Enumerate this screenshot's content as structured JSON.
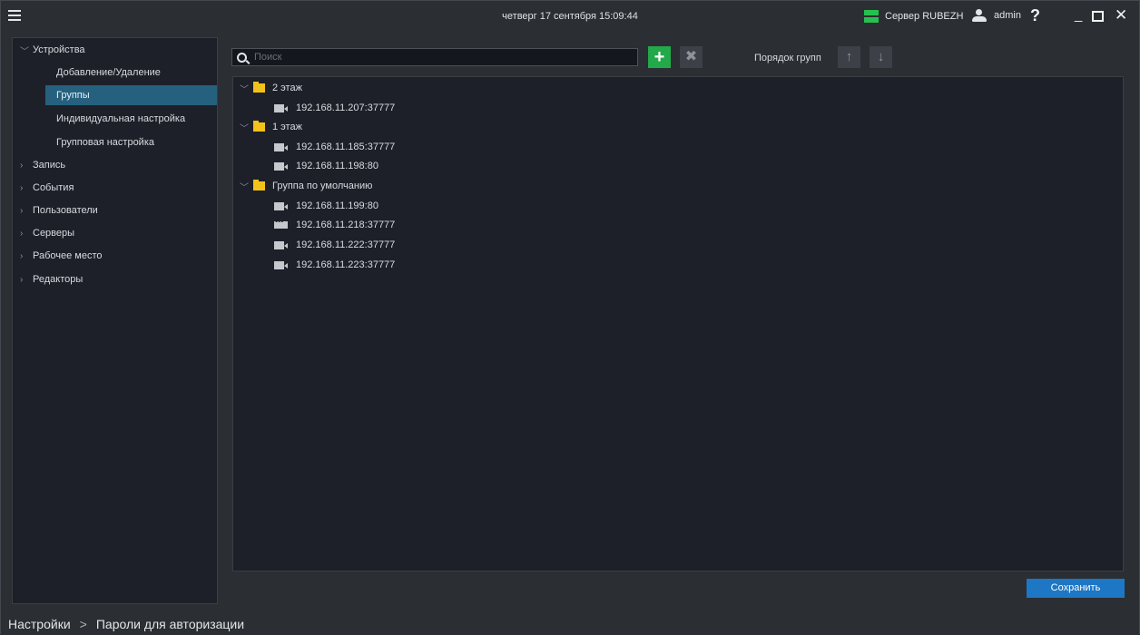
{
  "titlebar": {
    "datetime": "четверг 17 сентября 15:09:44",
    "server_label": "Сервер RUBEZH",
    "user_label": "admin",
    "help_label": "?",
    "minimize_label": "_",
    "close_label": "✕"
  },
  "sidebar": {
    "root": "Устройства",
    "children": [
      "Добавление/Удаление",
      "Группы",
      "Индивидуальная настройка",
      "Групповая настройка"
    ],
    "selected": "Группы",
    "sections": [
      "Запись",
      "События",
      "Пользователи",
      "Серверы",
      "Рабочее место",
      "Редакторы"
    ]
  },
  "toolbar": {
    "search_placeholder": "Поиск",
    "add_label": "+",
    "delete_label": "✖",
    "order_label": "Порядок групп",
    "up_label": "↑",
    "down_label": "↓"
  },
  "groups": [
    {
      "name": "2 этаж",
      "cameras": [
        "192.168.11.207:37777"
      ]
    },
    {
      "name": "1 этаж",
      "cameras": [
        "192.168.11.185:37777",
        "192.168.11.198:80"
      ]
    },
    {
      "name": "Группа по умолчанию",
      "cameras": [
        "192.168.11.199:80",
        "192.168.11.218:37777",
        "192.168.11.222:37777",
        "192.168.11.223:37777"
      ]
    }
  ],
  "save_label": "Сохранить",
  "footer": {
    "crumb_root": "Настройки",
    "separator": ">",
    "crumb_current": "Пароли для авторизации"
  },
  "colors": {
    "accent_green": "#22a94a",
    "selected_blue": "#25607e",
    "save_blue": "#1d77c4",
    "folder_yellow": "#f2c21b"
  }
}
